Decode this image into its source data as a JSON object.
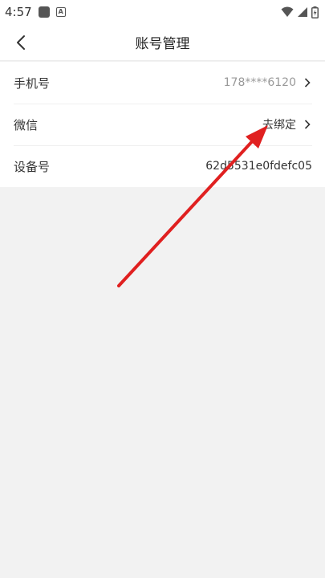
{
  "status_bar": {
    "time": "4:57",
    "icons": [
      "app-square-icon",
      "a-badge-icon",
      "wifi-icon",
      "signal-icon",
      "battery-icon"
    ]
  },
  "header": {
    "title": "账号管理",
    "back_icon": "chevron-left-icon"
  },
  "account_rows": [
    {
      "label": "手机号",
      "value": "178****6120",
      "has_chevron": true
    },
    {
      "label": "微信",
      "value": "去绑定",
      "has_chevron": true
    },
    {
      "label": "设备号",
      "value": "62d5531e0fdefc05",
      "has_chevron": false
    }
  ],
  "colors": {
    "background": "#f2f2f2",
    "card": "#ffffff",
    "muted_text": "#999999",
    "annotation_arrow": "#e02020"
  }
}
